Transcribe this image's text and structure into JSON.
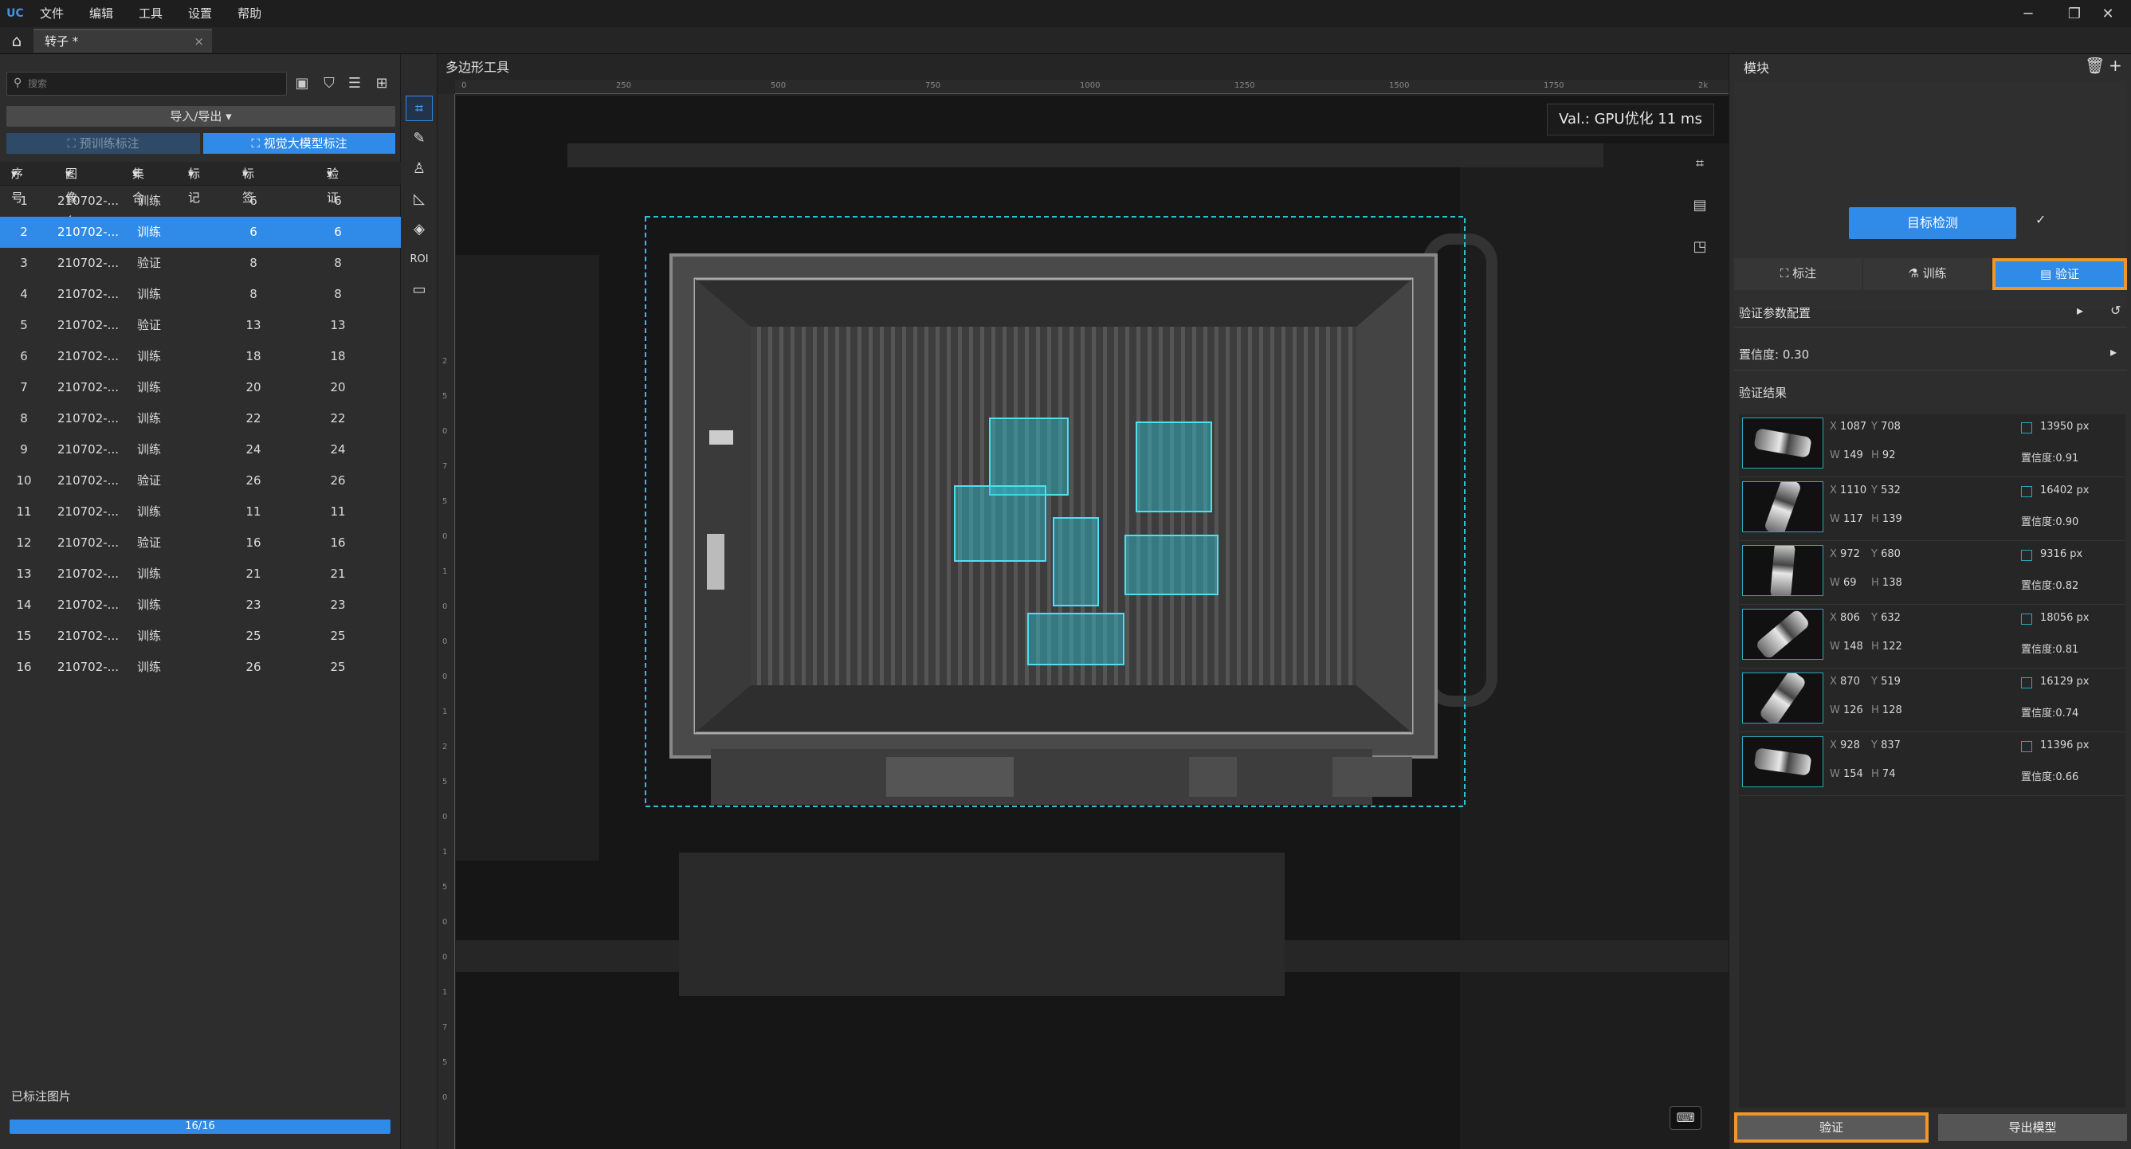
{
  "app": {
    "logo": "UC"
  },
  "menu": [
    "文件",
    "编辑",
    "工具",
    "设置",
    "帮助"
  ],
  "window_controls": {
    "min": "─",
    "max": "❐",
    "close": "✕"
  },
  "doc_tab": {
    "title": "转子 *",
    "close": "×"
  },
  "left": {
    "search_placeholder": "搜索",
    "import_export": "导入/导出 ▾",
    "pretrain_label": "预训练标注",
    "vision_label": "视觉大模型标注",
    "headers": [
      "序号",
      "图像名",
      "集合",
      "标记",
      "标签",
      "验证"
    ],
    "rows": [
      [
        "1",
        "210702-...",
        "训练",
        "",
        "6",
        "6"
      ],
      [
        "2",
        "210702-...",
        "训练",
        "",
        "6",
        "6"
      ],
      [
        "3",
        "210702-...",
        "验证",
        "",
        "8",
        "8"
      ],
      [
        "4",
        "210702-...",
        "训练",
        "",
        "8",
        "8"
      ],
      [
        "5",
        "210702-...",
        "验证",
        "",
        "13",
        "13"
      ],
      [
        "6",
        "210702-...",
        "训练",
        "",
        "18",
        "18"
      ],
      [
        "7",
        "210702-...",
        "训练",
        "",
        "20",
        "20"
      ],
      [
        "8",
        "210702-...",
        "训练",
        "",
        "22",
        "22"
      ],
      [
        "9",
        "210702-...",
        "训练",
        "",
        "24",
        "24"
      ],
      [
        "10",
        "210702-...",
        "验证",
        "",
        "26",
        "26"
      ],
      [
        "11",
        "210702-...",
        "训练",
        "",
        "11",
        "11"
      ],
      [
        "12",
        "210702-...",
        "验证",
        "",
        "16",
        "16"
      ],
      [
        "13",
        "210702-...",
        "训练",
        "",
        "21",
        "21"
      ],
      [
        "14",
        "210702-...",
        "训练",
        "",
        "23",
        "23"
      ],
      [
        "15",
        "210702-...",
        "训练",
        "",
        "25",
        "25"
      ],
      [
        "16",
        "210702-...",
        "训练",
        "",
        "26",
        "25"
      ]
    ],
    "selected_row": 1,
    "labeled_title": "已标注图片",
    "progress_text": "16/16",
    "progress_fraction": 1.0
  },
  "canvas": {
    "title": "多边形工具",
    "ruler_h": [
      "0",
      "250",
      "500",
      "750",
      "1000",
      "1250",
      "1500",
      "1750",
      "2k"
    ],
    "ruler_v": [
      "2",
      "5",
      "0",
      "7",
      "5",
      "0",
      "1",
      "0",
      "0",
      "0",
      "1",
      "2",
      "5",
      "0",
      "1",
      "5",
      "0",
      "0",
      "1",
      "7",
      "5",
      "0"
    ],
    "val_text": "Val.: GPU优化 11 ms"
  },
  "right": {
    "title": "模块",
    "module_label": "目标检测",
    "tabs": [
      "标注",
      "训练",
      "验证"
    ],
    "params_title": "验证参数配置",
    "confidence": "置信度: 0.30",
    "results_title": "验证结果",
    "results": [
      {
        "x": "1087",
        "y": "708",
        "w": "149",
        "h": "92",
        "area": "13950 px",
        "conf": "置信度:0.91"
      },
      {
        "x": "1110",
        "y": "532",
        "w": "117",
        "h": "139",
        "area": "16402 px",
        "conf": "置信度:0.90"
      },
      {
        "x": "972",
        "y": "680",
        "w": "69",
        "h": "138",
        "area": "9316 px",
        "conf": "置信度:0.82"
      },
      {
        "x": "806",
        "y": "632",
        "w": "148",
        "h": "122",
        "area": "18056 px",
        "conf": "置信度:0.81"
      },
      {
        "x": "870",
        "y": "519",
        "w": "126",
        "h": "128",
        "area": "16129 px",
        "conf": "置信度:0.74"
      },
      {
        "x": "928",
        "y": "837",
        "w": "154",
        "h": "74",
        "area": "11396 px",
        "conf": "置信度:0.66"
      }
    ],
    "verify_btn": "验证",
    "export_btn": "导出模型"
  },
  "colors": {
    "accent": "#2f8ae8",
    "highlight": "#f0962a",
    "detect": "#2ec4d4"
  }
}
